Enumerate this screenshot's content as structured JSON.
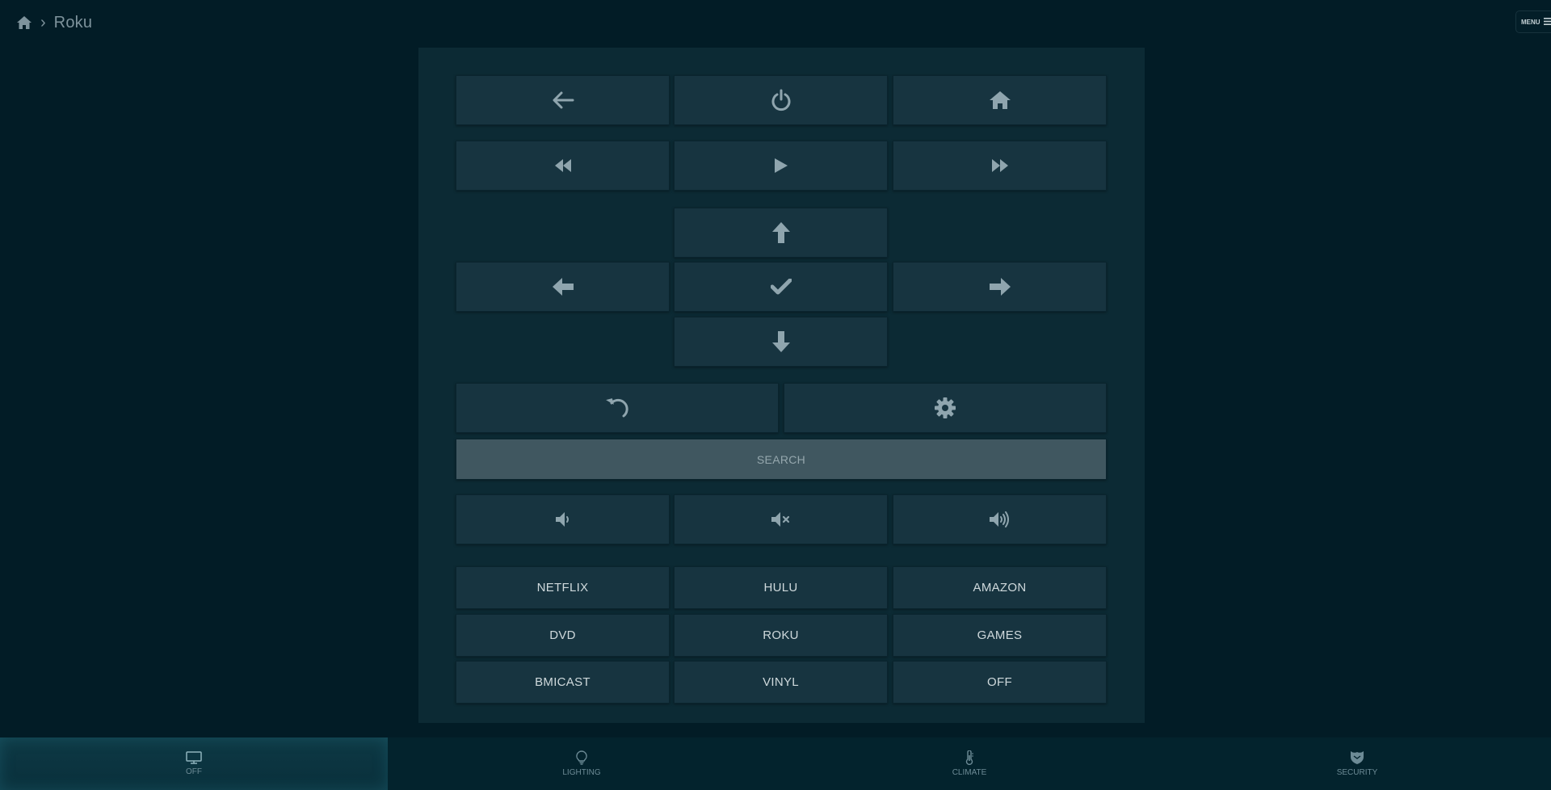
{
  "header": {
    "breadcrumb_separator": "›",
    "title": "Roku",
    "menu_label": "MENU",
    "home_icon": "home-icon",
    "menu_icon": "hamburger-icon"
  },
  "remote": {
    "row1": [
      "back-arrow-icon",
      "power-icon",
      "home-icon"
    ],
    "row2": [
      "rewind-icon",
      "play-icon",
      "fast-forward-icon"
    ],
    "dpad": [
      "arrow-up-icon",
      "arrow-left-icon",
      "check-icon",
      "arrow-right-icon",
      "arrow-down-icon"
    ],
    "row_options": [
      "replay-icon",
      "settings-gear-icon"
    ],
    "search_label": "SEARCH",
    "volume": [
      "volume-down-icon",
      "mute-icon",
      "volume-up-icon"
    ],
    "channels": [
      [
        "NETFLIX",
        "HULU",
        "AMAZON"
      ],
      [
        "DVD",
        "ROKU",
        "GAMES"
      ],
      [
        "BMICAST",
        "VINYL",
        "OFF"
      ]
    ]
  },
  "bottom_nav": [
    {
      "label": "OFF",
      "icon": "monitor-icon",
      "active": true
    },
    {
      "label": "LIGHTING",
      "icon": "lightbulb-icon",
      "active": false
    },
    {
      "label": "CLIMATE",
      "icon": "thermometer-icon",
      "active": false
    },
    {
      "label": "SECURITY",
      "icon": "shield-icon",
      "active": false
    }
  ],
  "colors": {
    "background": "#021c26",
    "panel": "#0c2a34",
    "button": "#173440",
    "search_button": "#405760",
    "icon": "#8fa5ae"
  }
}
